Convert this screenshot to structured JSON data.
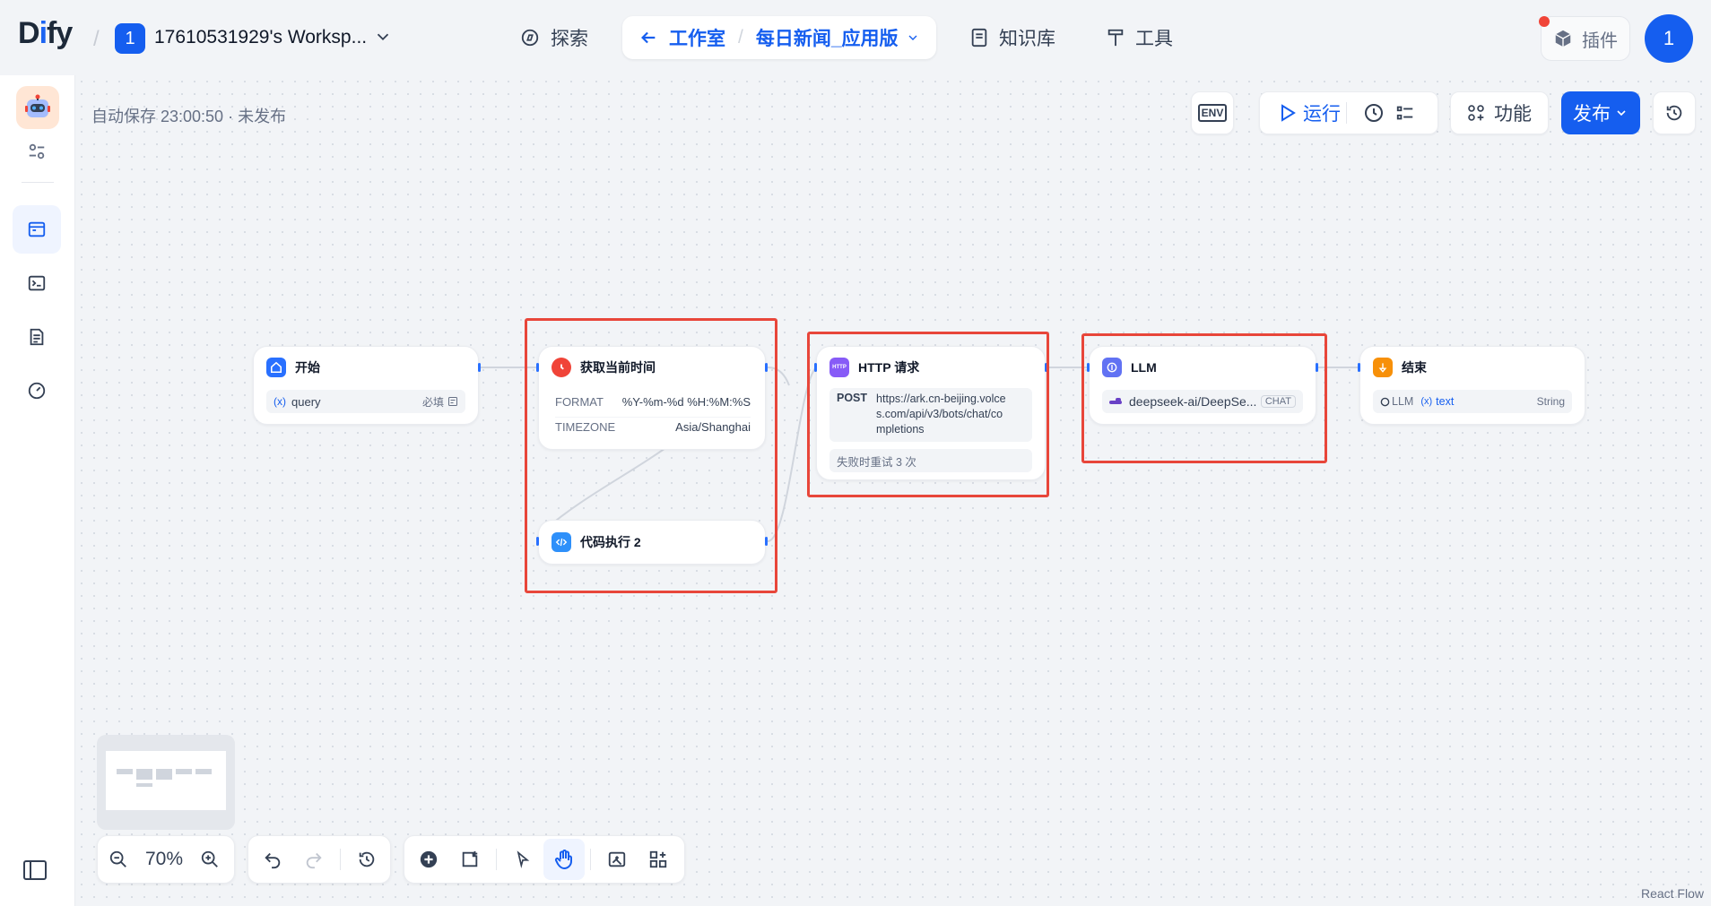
{
  "header": {
    "logo_left": "D",
    "logo_mid": "i",
    "logo_right": "fy",
    "workspace_badge": "1",
    "workspace_name": "17610531929's Worksp...",
    "nav_explore": "探索",
    "nav_studio": "工作室",
    "nav_app": "每日新闻_应用版",
    "nav_knowledge": "知识库",
    "nav_tools": "工具",
    "plugins": "插件",
    "avatar": "1"
  },
  "toolbar": {
    "autosave": "自动保存 23:00:50 · 未发布",
    "env": "ENV",
    "run": "运行",
    "features": "功能",
    "publish": "发布"
  },
  "nodes": {
    "start": {
      "title": "开始",
      "var": "query",
      "required": "必填"
    },
    "time": {
      "title": "获取当前时间",
      "rows": [
        {
          "k": "FORMAT",
          "v": "%Y-%m-%d %H:%M:%S"
        },
        {
          "k": "TIMEZONE",
          "v": "Asia/Shanghai"
        }
      ]
    },
    "code": {
      "title": "代码执行 2"
    },
    "http": {
      "title": "HTTP 请求",
      "method": "POST",
      "url_l1": "https://ark.cn-beijing.volce",
      "url_l2": "s.com/api/v3/bots/chat/co",
      "url_l3": "mpletions",
      "retry": "失败时重试 3 次",
      "icon_text": "HTTP"
    },
    "llm": {
      "title": "LLM",
      "model": "deepseek-ai/DeepSe...",
      "mode": "CHAT"
    },
    "end": {
      "title": "结束",
      "src": "LLM",
      "var": "text",
      "type": "String"
    }
  },
  "bottom": {
    "zoom": "70%"
  },
  "footer": {
    "attribution": "React Flow"
  },
  "colors": {
    "accent": "#155eef",
    "highlight": "#e8463a",
    "start_icon": "#2970ff",
    "time_icon": "#f04438",
    "code_icon": "#2e90fa",
    "http_icon": "#875bf7",
    "llm_icon": "#6172f3",
    "end_icon": "#f79009"
  }
}
